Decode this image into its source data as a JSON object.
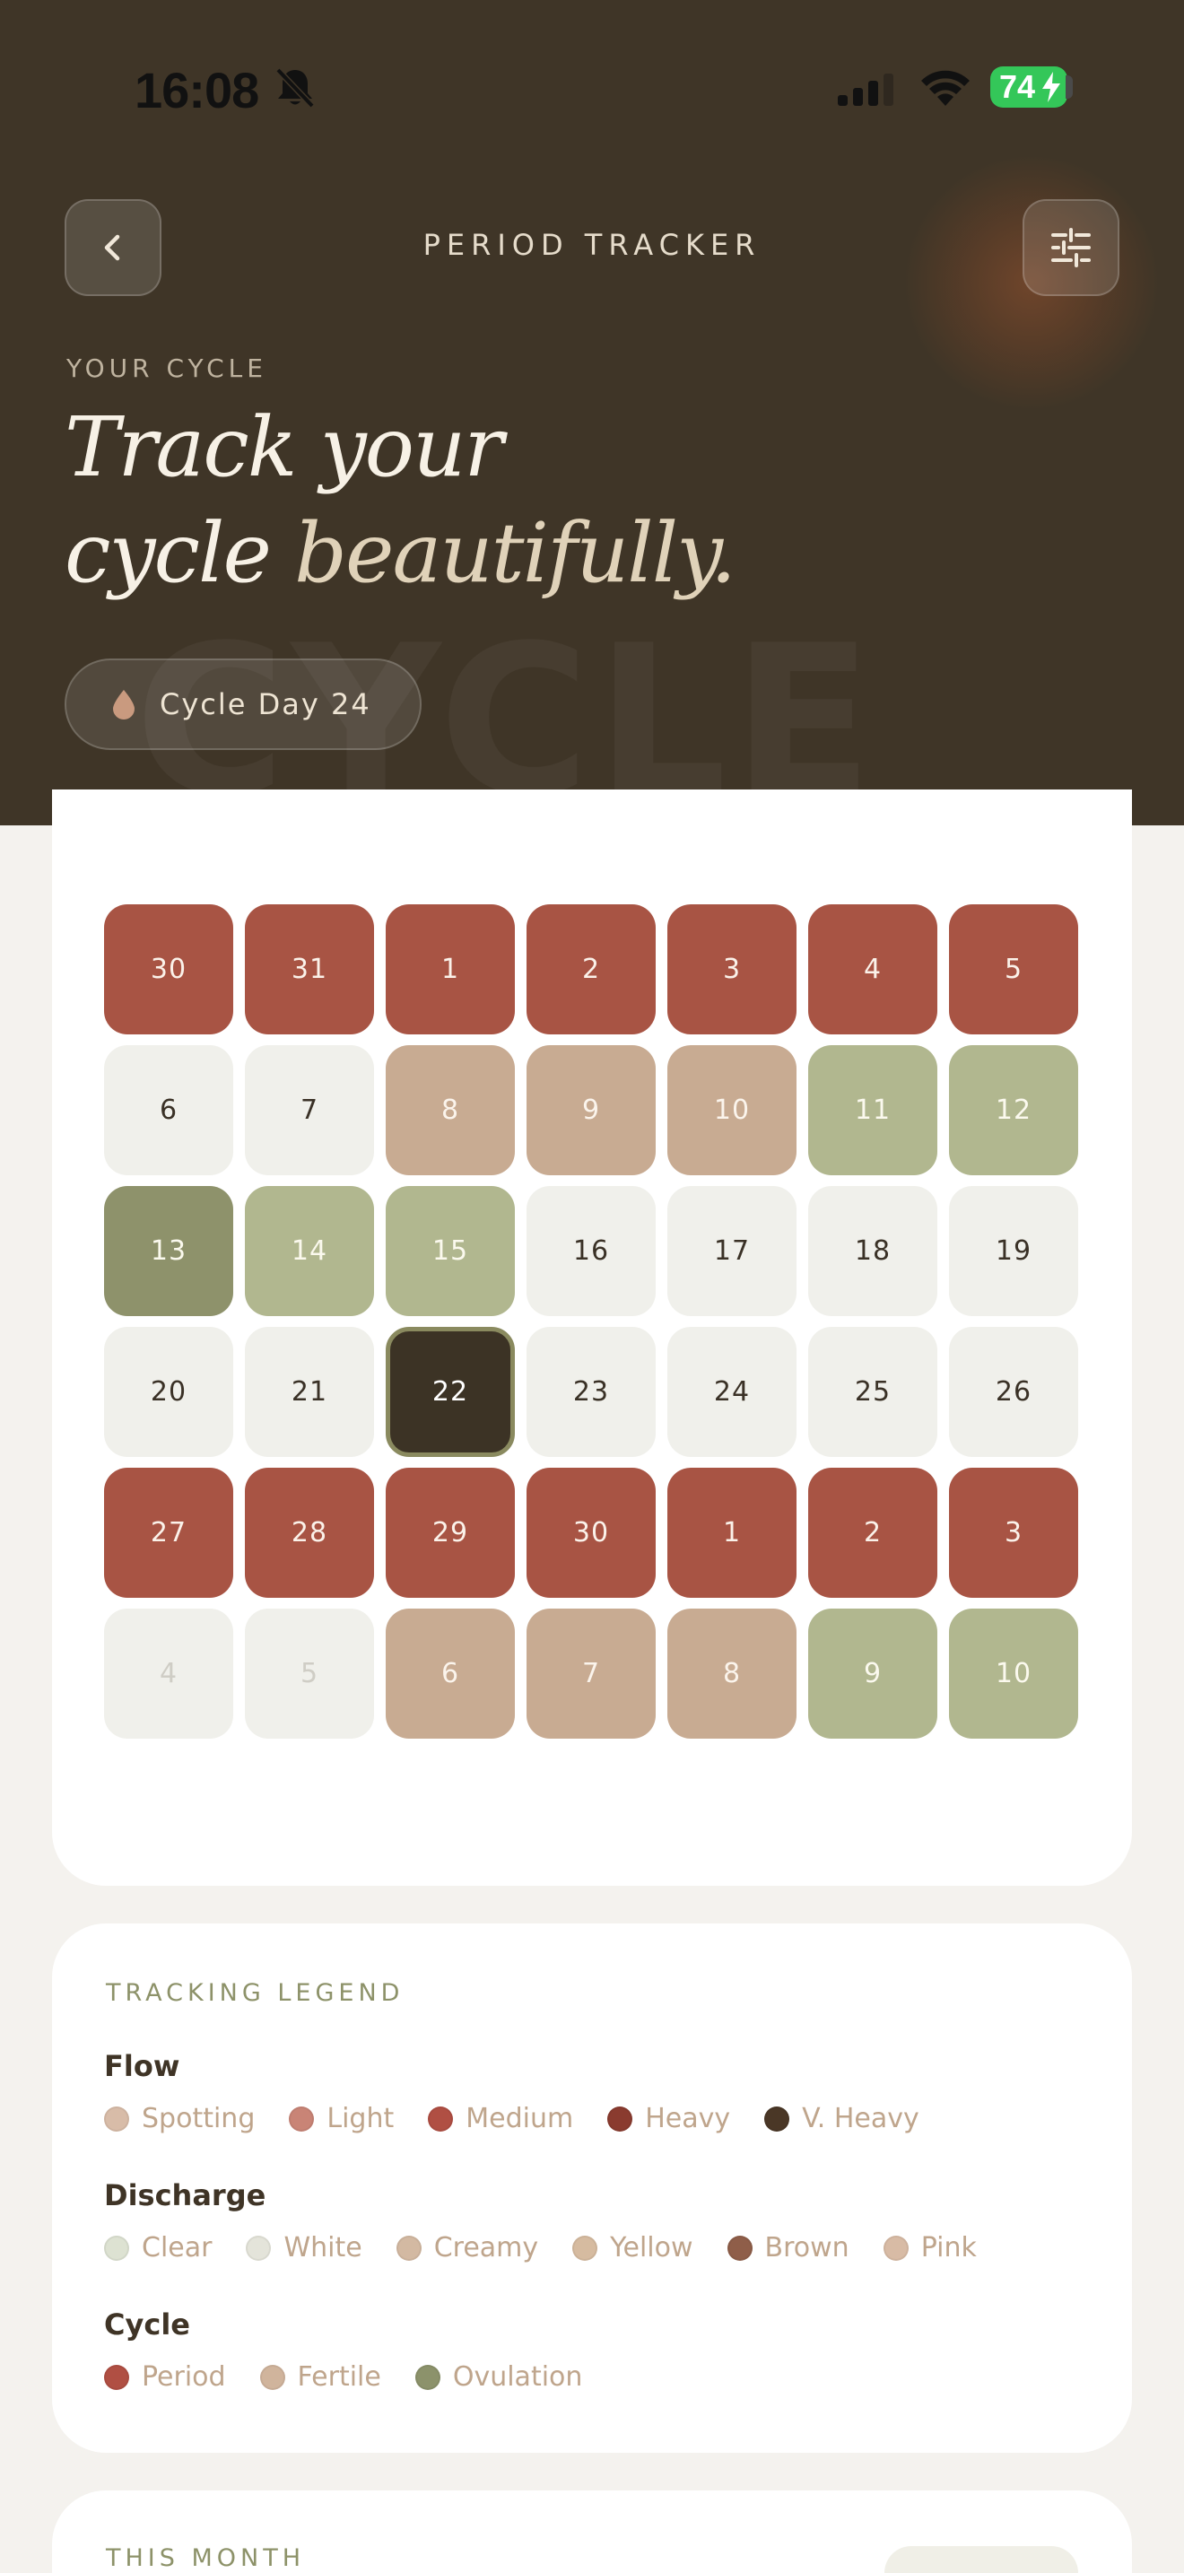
{
  "status_bar": {
    "time": "16:08",
    "battery": "74"
  },
  "nav": {
    "title": "PERIOD TRACKER",
    "back_icon": "chevron-left-icon",
    "filter_icon": "sliders-icon"
  },
  "hero": {
    "eyebrow": "YOUR CYCLE",
    "headline_line1": "Track your",
    "headline_line2_a": "cycle ",
    "headline_line2_b": "beautifully.",
    "watermark": "CYCLE",
    "cycle_pill": "Cycle Day 24"
  },
  "calendar": {
    "days": [
      {
        "label": "30",
        "type": "period"
      },
      {
        "label": "31",
        "type": "period"
      },
      {
        "label": "1",
        "type": "period"
      },
      {
        "label": "2",
        "type": "period"
      },
      {
        "label": "3",
        "type": "period"
      },
      {
        "label": "4",
        "type": "period"
      },
      {
        "label": "5",
        "type": "period"
      },
      {
        "label": "6",
        "type": "plain"
      },
      {
        "label": "7",
        "type": "plain"
      },
      {
        "label": "8",
        "type": "fertile"
      },
      {
        "label": "9",
        "type": "fertile"
      },
      {
        "label": "10",
        "type": "fertile"
      },
      {
        "label": "11",
        "type": "ovul"
      },
      {
        "label": "12",
        "type": "ovul"
      },
      {
        "label": "13",
        "type": "peak"
      },
      {
        "label": "14",
        "type": "ovul"
      },
      {
        "label": "15",
        "type": "ovul"
      },
      {
        "label": "16",
        "type": "plain"
      },
      {
        "label": "17",
        "type": "plain"
      },
      {
        "label": "18",
        "type": "plain"
      },
      {
        "label": "19",
        "type": "plain"
      },
      {
        "label": "20",
        "type": "plain"
      },
      {
        "label": "21",
        "type": "plain"
      },
      {
        "label": "22",
        "type": "today"
      },
      {
        "label": "23",
        "type": "plain"
      },
      {
        "label": "24",
        "type": "plain"
      },
      {
        "label": "25",
        "type": "plain"
      },
      {
        "label": "26",
        "type": "plain"
      },
      {
        "label": "27",
        "type": "period"
      },
      {
        "label": "28",
        "type": "period"
      },
      {
        "label": "29",
        "type": "period"
      },
      {
        "label": "30",
        "type": "period"
      },
      {
        "label": "1",
        "type": "period"
      },
      {
        "label": "2",
        "type": "period"
      },
      {
        "label": "3",
        "type": "period"
      },
      {
        "label": "4",
        "type": "faded"
      },
      {
        "label": "5",
        "type": "faded"
      },
      {
        "label": "6",
        "type": "fertile"
      },
      {
        "label": "7",
        "type": "fertile"
      },
      {
        "label": "8",
        "type": "fertile"
      },
      {
        "label": "9",
        "type": "ovul"
      },
      {
        "label": "10",
        "type": "ovul"
      }
    ]
  },
  "legend": {
    "title": "TRACKING LEGEND",
    "groups": [
      {
        "label": "Flow",
        "items": [
          {
            "label": "Spotting",
            "color": "#d8bca8"
          },
          {
            "label": "Light",
            "color": "#c98476"
          },
          {
            "label": "Medium",
            "color": "#b04f43"
          },
          {
            "label": "Heavy",
            "color": "#8a3b2f"
          },
          {
            "label": "V. Heavy",
            "color": "#4a3726"
          }
        ]
      },
      {
        "label": "Discharge",
        "items": [
          {
            "label": "Clear",
            "color": "#dde2d2"
          },
          {
            "label": "White",
            "color": "#e4e4da"
          },
          {
            "label": "Creamy",
            "color": "#d3b9a2"
          },
          {
            "label": "Yellow",
            "color": "#d6bba0"
          },
          {
            "label": "Brown",
            "color": "#8f5e49"
          },
          {
            "label": "Pink",
            "color": "#d8bba5"
          }
        ]
      },
      {
        "label": "Cycle",
        "items": [
          {
            "label": "Period",
            "color": "#b04f43"
          },
          {
            "label": "Fertile",
            "color": "#d0b49c"
          },
          {
            "label": "Ovulation",
            "color": "#8c926b"
          }
        ]
      }
    ]
  },
  "this_month": {
    "title": "THIS MONTH"
  }
}
